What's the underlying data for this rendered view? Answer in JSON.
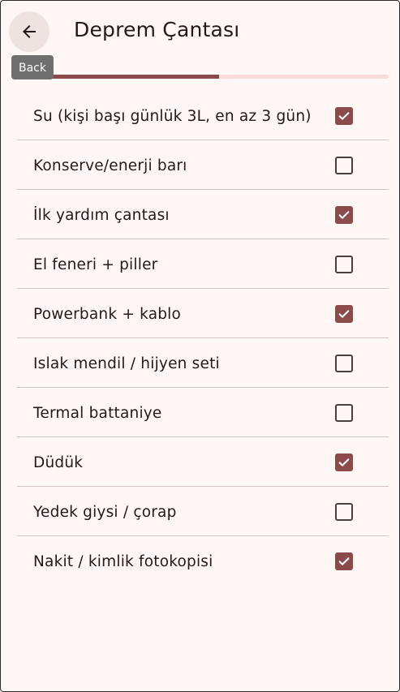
{
  "app_bar": {
    "title": "Deprem Çantası",
    "back_icon": "arrow-left-icon",
    "back_tooltip": "Back"
  },
  "progress": {
    "fraction": 0.5
  },
  "colors": {
    "background": "#fff7f6",
    "accent": "#8c4a4a",
    "track": "#f7dcd8",
    "divider": "#d8c2bf",
    "tooltip": "#6f6f6f"
  },
  "items": [
    {
      "label": "Su (kişi başı günlük 3L, en az 3 gün)",
      "checked": true
    },
    {
      "label": "Konserve/enerji barı",
      "checked": false
    },
    {
      "label": "İlk yardım çantası",
      "checked": true
    },
    {
      "label": "El feneri + piller",
      "checked": false
    },
    {
      "label": "Powerbank + kablo",
      "checked": true
    },
    {
      "label": "Islak mendil / hijyen seti",
      "checked": false
    },
    {
      "label": "Termal battaniye",
      "checked": false
    },
    {
      "label": "Düdük",
      "checked": true
    },
    {
      "label": "Yedek giysi / çorap",
      "checked": false
    },
    {
      "label": "Nakit / kimlik fotokopisi",
      "checked": true
    }
  ]
}
